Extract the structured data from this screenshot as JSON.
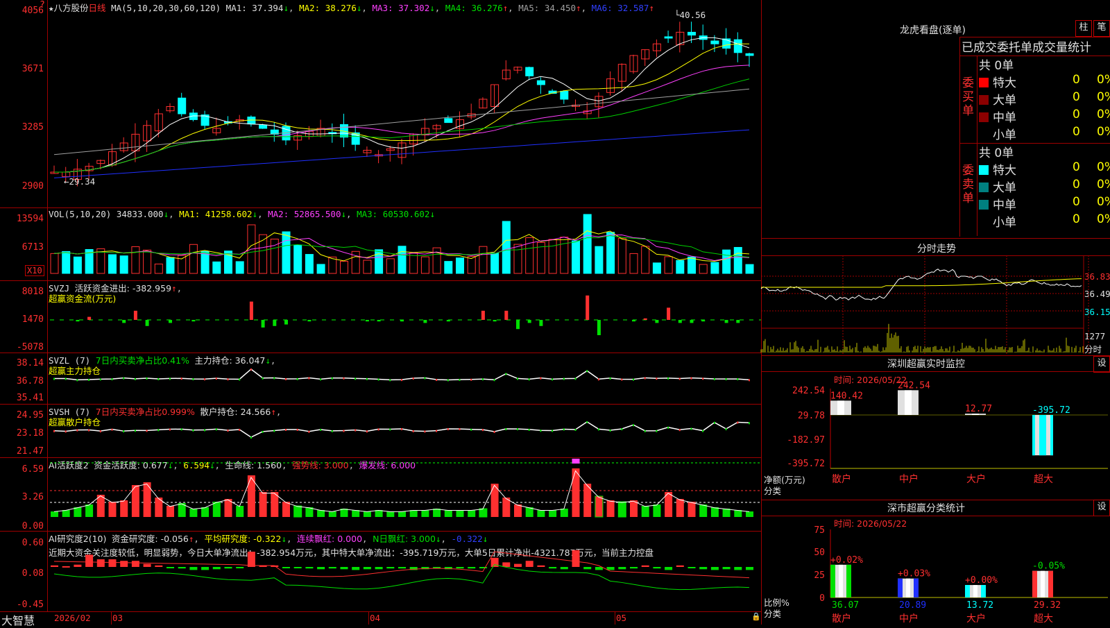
{
  "stock": {
    "name": "八方股份",
    "period": "日线"
  },
  "colors": {
    "up": "#ff3030",
    "down": "#00ffff",
    "frame": "#a00000",
    "bg": "#000000"
  },
  "main": {
    "ma_title": "MA(5,10,20,30,60,120)",
    "ma_values": [
      "MA1: 37.394",
      "MA2: 38.276",
      "MA3: 37.302",
      "MA4: 36.276",
      "MA5: 34.450",
      "MA6: 32.587"
    ],
    "y_labels": [
      "4056",
      "3671",
      "3285",
      "2900"
    ],
    "high_mark": "40.56",
    "low_mark": "29.34"
  },
  "vol": {
    "title": "VOL(5,10,20)",
    "value": "34833.000",
    "ma1": "MA1: 41258.602",
    "ma2": "MA2: 52865.500",
    "ma3": "MA3: 60530.602",
    "y_labels": [
      "13594",
      "6713"
    ],
    "unit": "X10"
  },
  "svzj": {
    "title": "SVZJ",
    "label": "活跃资金进出: -382.959",
    "subtitle": "超赢资金流(万元)",
    "y_labels": [
      "8018",
      "1470",
      "-5078"
    ]
  },
  "svzl": {
    "title": "SVZL (7)",
    "label1": "7日内买卖净占比0.41%",
    "label2": "主力持仓: 36.047",
    "subtitle": "超赢主力持仓",
    "y_labels": [
      "38.14",
      "36.78",
      "35.41"
    ]
  },
  "svsh": {
    "title": "SVSH (7)",
    "label1": "7日内买卖净占比0.999%",
    "label2": "散户持仓: 24.566",
    "subtitle": "超赢散户持仓",
    "y_labels": [
      "24.95",
      "23.18",
      "21.47"
    ]
  },
  "ai1": {
    "title": "AI活跃度2",
    "label": "资金活跃度: 0.677",
    "v2": "6.594",
    "v3": "生命线: 1.560",
    "v4": "强势线: 3.000",
    "v5": "爆发线: 6.000",
    "y_labels": [
      "6.59",
      "3.26",
      "0.00"
    ]
  },
  "ai2": {
    "title": "AI研究度2(10)",
    "label": "资金研究度: -0.056",
    "v2": "平均研究度: -0.322",
    "v3": "连续飘红: 0.000",
    "v4": "N日飘红: 3.000",
    "v5": "-0.322",
    "y_labels": [
      "0.60",
      "0.08",
      "-0.45"
    ],
    "note": "近期大资金关注度较低，明显弱势，今日大单净流出：-382.954万元，其中特大单净流出：-395.719万元，大单5日累计净出-4321.787万元，当前主力控盘"
  },
  "footer": {
    "brand": "大智慧",
    "dates": [
      "2026/02",
      "03",
      "04",
      "05"
    ]
  },
  "lhb": {
    "title": "龙虎看盘(逐单)",
    "btn1": "柱",
    "btn2": "笔",
    "header": "已成交委托单成交量统计",
    "buy_label": "委买单",
    "sell_label": "委卖单",
    "buy_total": "共 0单",
    "sell_total": "共 0单",
    "rows": [
      "特大",
      "大单",
      "中单",
      "小单"
    ],
    "zero": "0",
    "pct": "0%"
  },
  "fenshi": {
    "title": "分时走势",
    "y_labels": [
      "36.83",
      "36.49",
      "36.15"
    ],
    "vol_label": "1277",
    "unit": "分时"
  },
  "monitor": {
    "title": "深圳超赢实时监控",
    "btn": "设",
    "time": "时间: 2026/05/22",
    "y_labels": [
      "242.54",
      "29.78",
      "-182.97",
      "-395.72"
    ],
    "bars": [
      {
        "label": "散户",
        "value": "140.42"
      },
      {
        "label": "中户",
        "value": "242.54"
      },
      {
        "label": "大户",
        "value": "12.77"
      },
      {
        "label": "超大",
        "value": "-395.72"
      }
    ],
    "axis_title": "净额(万元)",
    "axis_sub": "分类"
  },
  "classify": {
    "title": "深市超赢分类统计",
    "btn": "设",
    "time": "时间: 2026/05/22",
    "y_labels": [
      "75",
      "50",
      "25",
      "0"
    ],
    "bars": [
      {
        "label": "散户",
        "value": "36.07",
        "delta": "+0.02%"
      },
      {
        "label": "中户",
        "value": "20.89",
        "delta": "+0.03%"
      },
      {
        "label": "大户",
        "value": "13.72",
        "delta": "+0.00%"
      },
      {
        "label": "超大",
        "value": "29.32",
        "delta": "-0.05%"
      }
    ],
    "axis_title": "比例%",
    "axis_sub": "分类"
  }
}
